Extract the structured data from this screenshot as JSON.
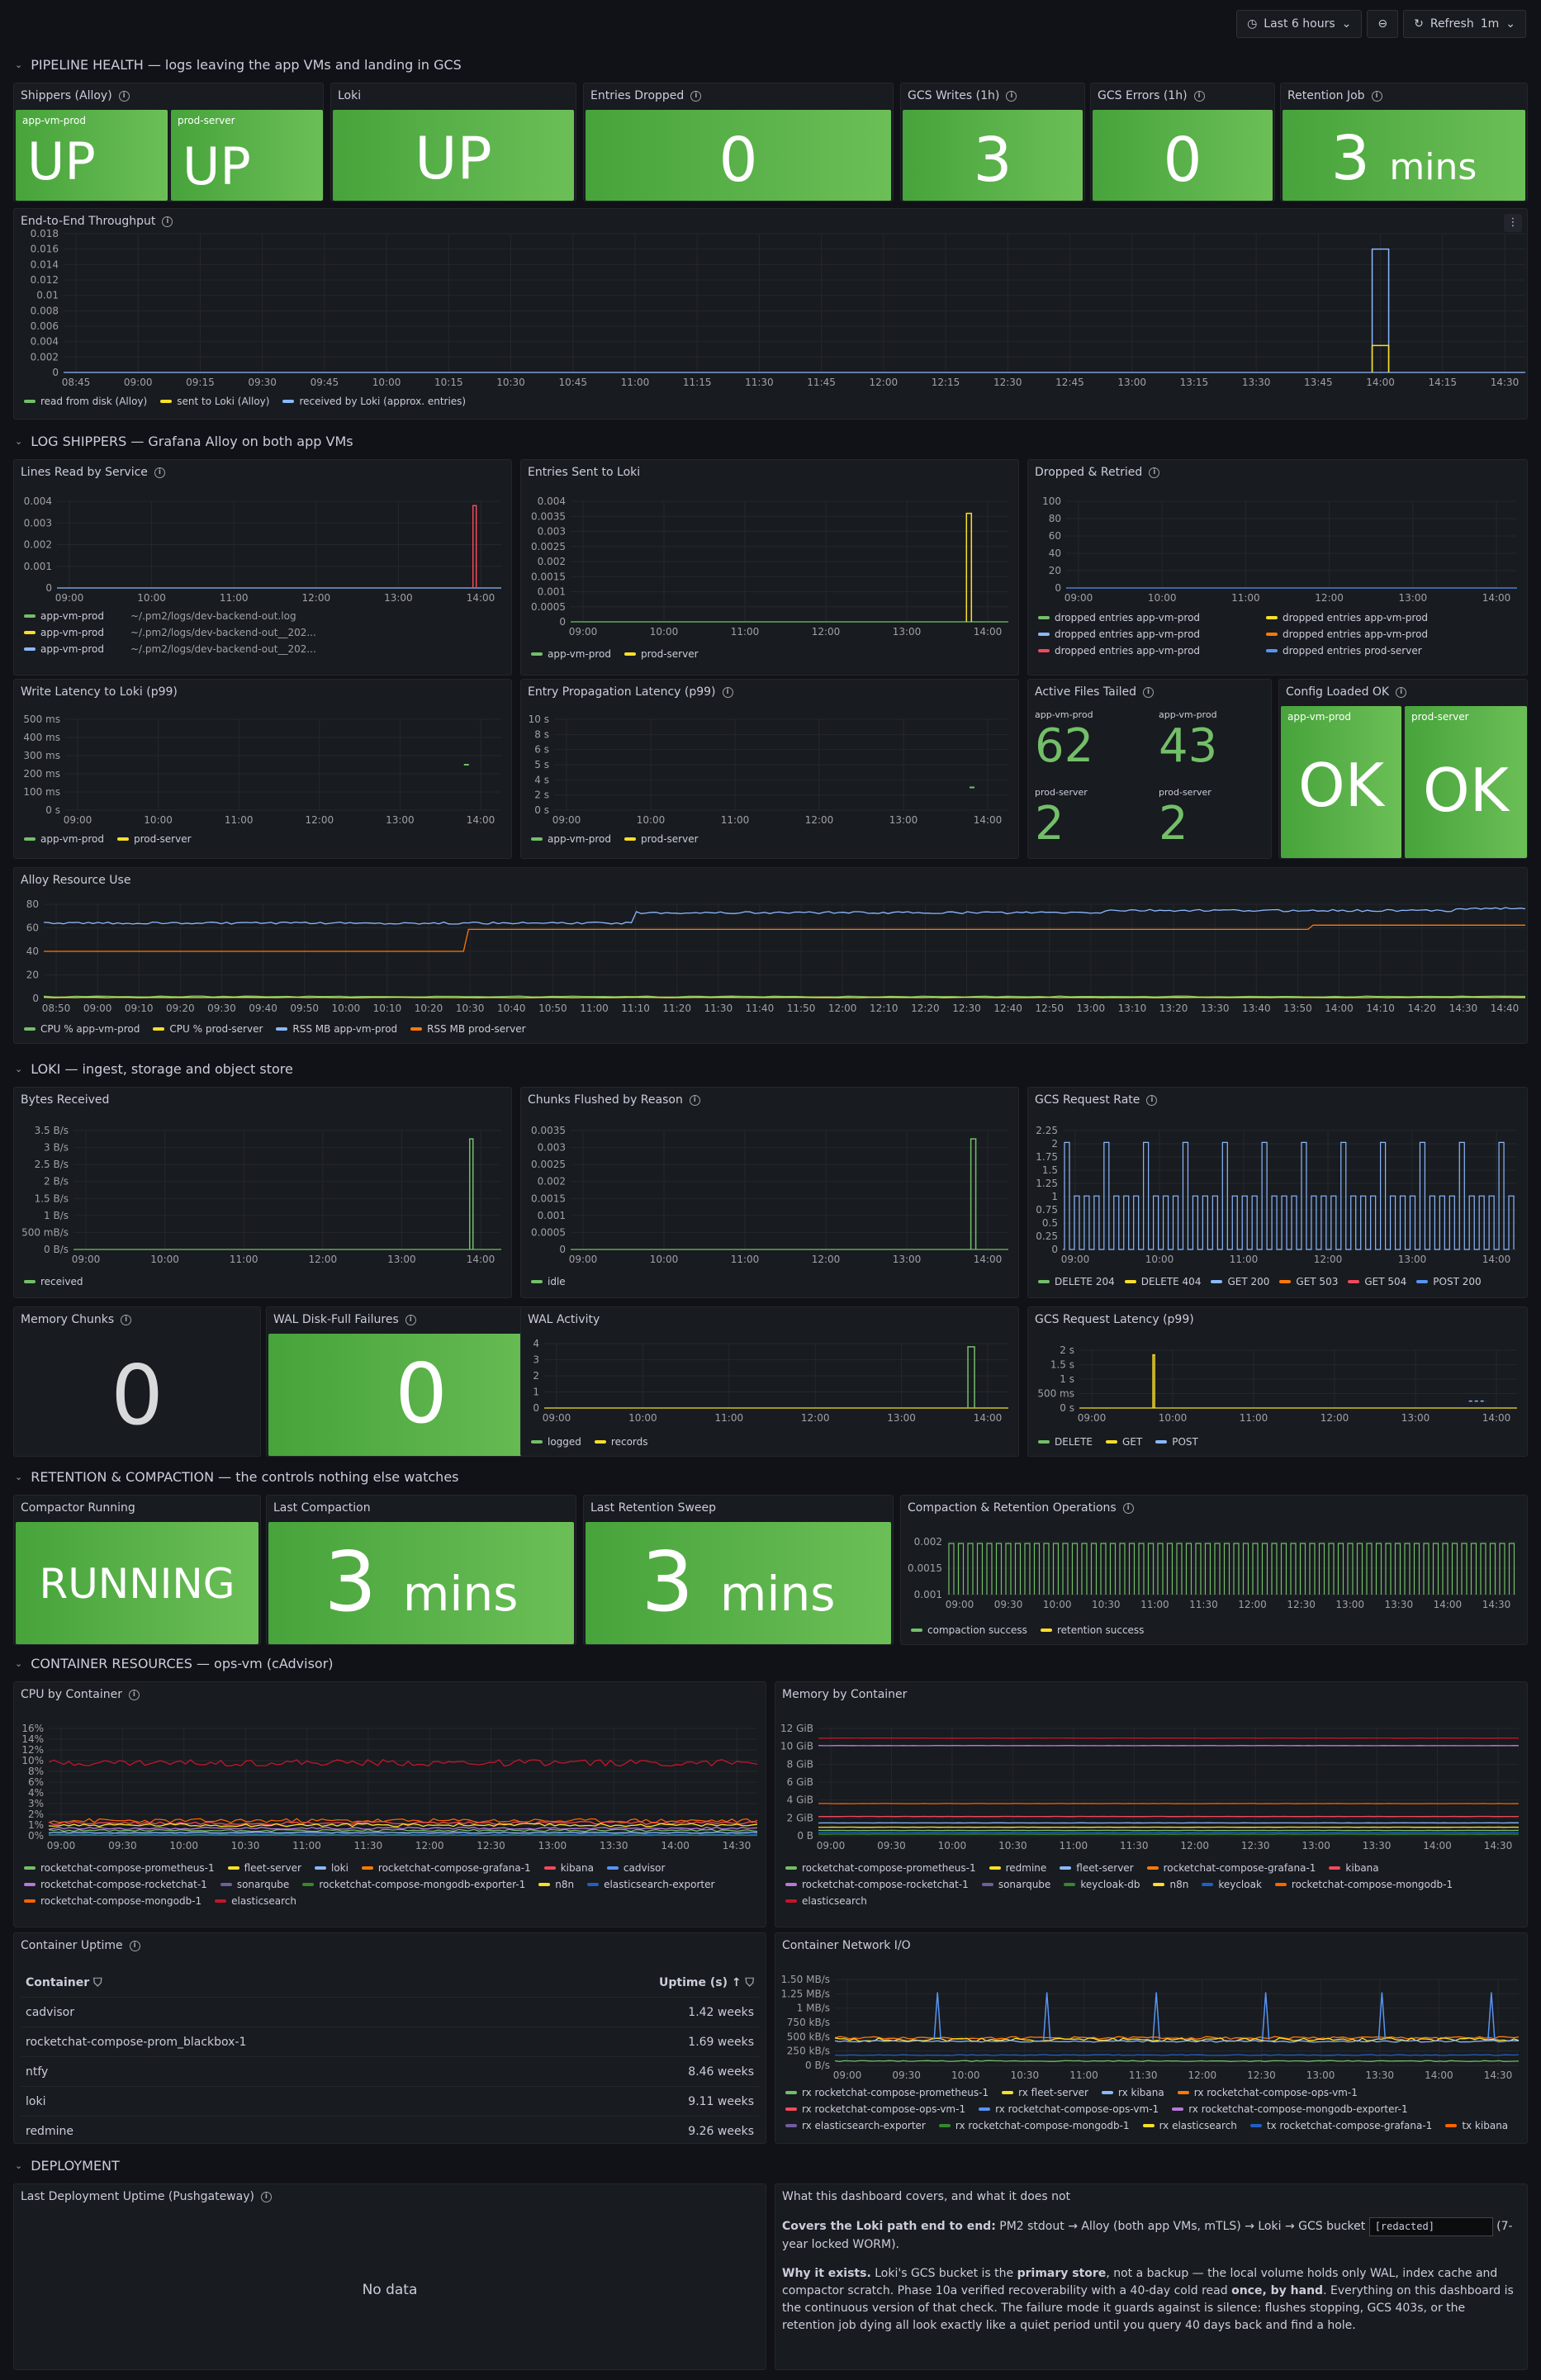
{
  "toolbar": {
    "time_range": "Last 6 hours",
    "refresh": "Refresh",
    "interval": "1m"
  },
  "rows": {
    "pipeline": "PIPELINE HEALTH — logs leaving the app VMs and landing in GCS",
    "shippers": "LOG SHIPPERS — Grafana Alloy on both app VMs",
    "loki": "LOKI — ingest, storage and object store",
    "retention": "RETENTION & COMPACTION — the controls nothing else watches",
    "containers": "CONTAINER RESOURCES — ops-vm (cAdvisor)",
    "deployment": "DEPLOYMENT"
  },
  "panels": {
    "shippers_alloy": {
      "title": "Shippers (Alloy)",
      "items": [
        {
          "sub": "app-vm-prod",
          "value": "UP"
        },
        {
          "sub": "prod-server",
          "value": "UP"
        }
      ]
    },
    "loki": {
      "title": "Loki",
      "value": "UP"
    },
    "entries_dropped": {
      "title": "Entries Dropped",
      "value": "0"
    },
    "gcs_writes": {
      "title": "GCS Writes (1h)",
      "value": "3"
    },
    "gcs_errors": {
      "title": "GCS Errors (1h)",
      "value": "0"
    },
    "retention_job": {
      "title": "Retention Job",
      "value": "3",
      "unit": "mins"
    },
    "throughput": {
      "title": "End-to-End Throughput"
    },
    "lines_read": {
      "title": "Lines Read by Service"
    },
    "entries_sent": {
      "title": "Entries Sent to Loki"
    },
    "dropped_retried": {
      "title": "Dropped & Retried"
    },
    "write_latency": {
      "title": "Write Latency to Loki (p99)"
    },
    "entry_propagation": {
      "title": "Entry Propagation Latency (p99)"
    },
    "active_files": {
      "title": "Active Files Tailed",
      "items": [
        {
          "sub": "app-vm-prod",
          "value": "62"
        },
        {
          "sub": "app-vm-prod",
          "value": "43"
        },
        {
          "sub": "prod-server",
          "value": "2"
        },
        {
          "sub": "prod-server",
          "value": "2"
        }
      ]
    },
    "config_loaded": {
      "title": "Config Loaded OK",
      "items": [
        {
          "sub": "app-vm-prod",
          "value": "OK"
        },
        {
          "sub": "prod-server",
          "value": "OK"
        }
      ]
    },
    "alloy_resource": {
      "title": "Alloy Resource Use"
    },
    "bytes_received": {
      "title": "Bytes Received"
    },
    "chunks_flushed": {
      "title": "Chunks Flushed by Reason"
    },
    "gcs_request_rate": {
      "title": "GCS Request Rate"
    },
    "memory_chunks": {
      "title": "Memory Chunks",
      "value": "0"
    },
    "wal_disk_full": {
      "title": "WAL Disk-Full Failures",
      "value": "0"
    },
    "wal_activity": {
      "title": "WAL Activity"
    },
    "gcs_request_latency": {
      "title": "GCS Request Latency (p99)"
    },
    "compactor_running": {
      "title": "Compactor Running",
      "value": "RUNNING"
    },
    "last_compaction": {
      "title": "Last Compaction",
      "value": "3",
      "unit": "mins"
    },
    "last_retention": {
      "title": "Last Retention Sweep",
      "value": "3",
      "unit": "mins"
    },
    "compaction_ops": {
      "title": "Compaction & Retention Operations"
    },
    "cpu_by_container": {
      "title": "CPU by Container"
    },
    "memory_by_container": {
      "title": "Memory by Container"
    },
    "container_uptime": {
      "title": "Container Uptime",
      "col1": "Container",
      "col2": "Uptime (s)",
      "rows": [
        [
          "cadvisor",
          "1.42 weeks"
        ],
        [
          "rocketchat-compose-prom_blackbox-1",
          "1.69 weeks"
        ],
        [
          "ntfy",
          "8.46 weeks"
        ],
        [
          "loki",
          "9.11 weeks"
        ],
        [
          "redmine",
          "9.26 weeks"
        ]
      ]
    },
    "container_network": {
      "title": "Container Network I/O"
    },
    "last_deployment": {
      "title": "Last Deployment Uptime (Pushgateway)",
      "nodata": "No data"
    },
    "text_panel": {
      "title": "What this dashboard covers, and what it does not",
      "p1a": "Covers the Loki path end to end:",
      "p1b": " PM2 stdout → Alloy (both app VMs, mTLS) → Loki → GCS bucket ",
      "redacted": "[redacted]",
      "p1c": " (7-year locked WORM).",
      "p2a": "Why it exists.",
      "p2b": " Loki's GCS bucket is the ",
      "p2c": "primary store",
      "p2d": ", not a backup — the local volume holds only WAL, index cache and compactor scratch. Phase 10a verified recoverability with a 40-day cold read ",
      "p2e": "once, by hand",
      "p2f": ". Everything on this dashboard is the continuous version of that check. The failure mode it guards against is silence: flushes stopping, GCS 403s, or the retention job dying all look exactly like a quiet period until you query 40 days back and find a hole."
    }
  },
  "chart_data": [
    {
      "id": "throughput",
      "type": "line",
      "x": [
        "08:45",
        "09:00",
        "09:15",
        "09:30",
        "09:45",
        "10:00",
        "10:15",
        "10:30",
        "10:45",
        "11:00",
        "11:15",
        "11:30",
        "11:45",
        "12:00",
        "12:15",
        "12:30",
        "12:45",
        "13:00",
        "13:15",
        "13:30",
        "13:45",
        "14:00",
        "14:15",
        "14:30"
      ],
      "yticks": [
        "0",
        "0.002",
        "0.004",
        "0.006",
        "0.008",
        "0.01",
        "0.012",
        "0.014",
        "0.016",
        "0.018"
      ],
      "ylim": [
        0,
        0.018
      ],
      "series": [
        {
          "name": "read from disk (Alloy)",
          "color": "#73bf69"
        },
        {
          "name": "sent to Loki (Alloy)",
          "color": "#fade2a"
        },
        {
          "name": "received by Loki (approx. entries)",
          "color": "#8ab8ff"
        }
      ],
      "spikes": [
        {
          "x": "14:00",
          "read": 0.0035,
          "sent": 0.0035,
          "received": 0.016
        }
      ]
    },
    {
      "id": "lines_read",
      "type": "line",
      "x": [
        "09:00",
        "10:00",
        "11:00",
        "12:00",
        "13:00",
        "14:00"
      ],
      "yticks": [
        "0",
        "0.001",
        "0.002",
        "0.003",
        "0.004"
      ],
      "ylim": [
        0,
        0.004
      ],
      "series": [
        {
          "name": "app-vm-prod",
          "label": "~/.pm2/logs/dev-backend-out.log",
          "color": "#73bf69"
        },
        {
          "name": "app-vm-prod",
          "label": "~/.pm2/logs/dev-backend-out__202...",
          "color": "#fade2a"
        },
        {
          "name": "app-vm-prod",
          "label": "~/.pm2/logs/dev-backend-out__202...",
          "color": "#8ab8ff"
        }
      ]
    },
    {
      "id": "entries_sent",
      "type": "line",
      "x": [
        "09:00",
        "10:00",
        "11:00",
        "12:00",
        "13:00",
        "14:00"
      ],
      "yticks": [
        "0",
        "0.0005",
        "0.001",
        "0.0015",
        "0.002",
        "0.0025",
        "0.003",
        "0.0035",
        "0.004"
      ],
      "ylim": [
        0,
        0.004
      ],
      "series": [
        {
          "name": "app-vm-prod",
          "color": "#73bf69"
        },
        {
          "name": "prod-server",
          "color": "#fade2a"
        }
      ]
    },
    {
      "id": "dropped_retried",
      "type": "line",
      "x": [
        "09:00",
        "10:00",
        "11:00",
        "12:00",
        "13:00",
        "14:00"
      ],
      "yticks": [
        "0",
        "20",
        "40",
        "60",
        "80",
        "100"
      ],
      "ylim": [
        0,
        100
      ],
      "series": [
        {
          "name": "dropped entries app-vm-prod",
          "color": "#73bf69"
        },
        {
          "name": "dropped entries app-vm-prod",
          "color": "#fade2a"
        },
        {
          "name": "dropped entries app-vm-prod",
          "color": "#8ab8ff"
        },
        {
          "name": "dropped entries app-vm-prod",
          "color": "#ff780a"
        },
        {
          "name": "dropped entries app-vm-prod",
          "color": "#f2495c"
        },
        {
          "name": "dropped entries prod-server",
          "color": "#5794f2"
        }
      ]
    },
    {
      "id": "write_latency",
      "type": "line",
      "x": [
        "09:00",
        "10:00",
        "11:00",
        "12:00",
        "13:00",
        "14:00"
      ],
      "yticks": [
        "0 s",
        "100 ms",
        "200 ms",
        "300 ms",
        "400 ms",
        "500 ms"
      ],
      "series": [
        {
          "name": "app-vm-prod",
          "color": "#73bf69"
        },
        {
          "name": "prod-server",
          "color": "#fade2a"
        }
      ]
    },
    {
      "id": "entry_propagation",
      "type": "line",
      "x": [
        "09:00",
        "10:00",
        "11:00",
        "12:00",
        "13:00",
        "14:00"
      ],
      "yticks": [
        "0 s",
        "2 s",
        "4 s",
        "5 s",
        "6 s",
        "8 s",
        "10 s"
      ],
      "series": [
        {
          "name": "app-vm-prod",
          "color": "#73bf69"
        },
        {
          "name": "prod-server",
          "color": "#fade2a"
        }
      ]
    },
    {
      "id": "alloy_resource",
      "type": "line",
      "x": [
        "08:50",
        "09:00",
        "09:10",
        "09:20",
        "09:30",
        "09:40",
        "09:50",
        "10:00",
        "10:10",
        "10:20",
        "10:30",
        "10:40",
        "10:50",
        "11:00",
        "11:10",
        "11:20",
        "11:30",
        "11:40",
        "11:50",
        "12:00",
        "12:10",
        "12:20",
        "12:30",
        "12:40",
        "12:50",
        "13:00",
        "13:10",
        "13:20",
        "13:30",
        "13:40",
        "13:50",
        "14:00",
        "14:10",
        "14:20",
        "14:30",
        "14:40"
      ],
      "yticks": [
        "0",
        "20",
        "40",
        "60",
        "80"
      ],
      "ylim": [
        0,
        90
      ],
      "series": [
        {
          "name": "CPU % app-vm-prod",
          "color": "#73bf69"
        },
        {
          "name": "CPU % prod-server",
          "color": "#fade2a"
        },
        {
          "name": "RSS MB app-vm-prod",
          "color": "#8ab8ff"
        },
        {
          "name": "RSS MB prod-server",
          "color": "#ff780a"
        }
      ]
    },
    {
      "id": "bytes_received",
      "type": "line",
      "x": [
        "09:00",
        "10:00",
        "11:00",
        "12:00",
        "13:00",
        "14:00"
      ],
      "yticks": [
        "0 B/s",
        "500 mB/s",
        "1 B/s",
        "1.5 B/s",
        "2 B/s",
        "2.5 B/s",
        "3 B/s",
        "3.5 B/s"
      ],
      "series": [
        {
          "name": "received",
          "color": "#73bf69"
        }
      ]
    },
    {
      "id": "chunks_flushed",
      "type": "line",
      "x": [
        "09:00",
        "10:00",
        "11:00",
        "12:00",
        "13:00",
        "14:00"
      ],
      "yticks": [
        "0",
        "0.0005",
        "0.001",
        "0.0015",
        "0.002",
        "0.0025",
        "0.003",
        "0.0035"
      ],
      "series": [
        {
          "name": "idle",
          "color": "#73bf69"
        }
      ]
    },
    {
      "id": "gcs_request_rate",
      "type": "line",
      "x": [
        "09:00",
        "10:00",
        "11:00",
        "12:00",
        "13:00",
        "14:00"
      ],
      "yticks": [
        "0",
        "0.25",
        "0.5",
        "0.75",
        "1",
        "1.25",
        "1.5",
        "1.75",
        "2",
        "2.25"
      ],
      "series": [
        {
          "name": "DELETE 204",
          "color": "#73bf69"
        },
        {
          "name": "DELETE 404",
          "color": "#fade2a"
        },
        {
          "name": "GET 200",
          "color": "#8ab8ff"
        },
        {
          "name": "GET 503",
          "color": "#ff780a"
        },
        {
          "name": "GET 504",
          "color": "#f2495c"
        },
        {
          "name": "POST 200",
          "color": "#5794f2"
        }
      ]
    },
    {
      "id": "wal_activity",
      "type": "line",
      "x": [
        "09:00",
        "10:00",
        "11:00",
        "12:00",
        "13:00",
        "14:00"
      ],
      "yticks": [
        "0",
        "1",
        "2",
        "3",
        "4"
      ],
      "series": [
        {
          "name": "logged",
          "color": "#73bf69"
        },
        {
          "name": "records",
          "color": "#fade2a"
        }
      ]
    },
    {
      "id": "gcs_request_latency",
      "type": "line",
      "x": [
        "09:00",
        "10:00",
        "11:00",
        "12:00",
        "13:00",
        "14:00"
      ],
      "yticks": [
        "0 s",
        "500 ms",
        "1 s",
        "1.5 s",
        "2 s"
      ],
      "series": [
        {
          "name": "DELETE",
          "color": "#73bf69"
        },
        {
          "name": "GET",
          "color": "#fade2a"
        },
        {
          "name": "POST",
          "color": "#8ab8ff"
        }
      ]
    },
    {
      "id": "compaction_ops",
      "type": "line",
      "x": [
        "09:00",
        "09:30",
        "10:00",
        "10:30",
        "11:00",
        "11:30",
        "12:00",
        "12:30",
        "13:00",
        "13:30",
        "14:00",
        "14:30"
      ],
      "yticks": [
        "0.001",
        "0.0015",
        "0.002"
      ],
      "series": [
        {
          "name": "compaction success",
          "color": "#73bf69"
        },
        {
          "name": "retention success",
          "color": "#fade2a"
        }
      ]
    },
    {
      "id": "cpu_by_container",
      "type": "line",
      "x": [
        "09:00",
        "09:30",
        "10:00",
        "10:30",
        "11:00",
        "11:30",
        "12:00",
        "12:30",
        "13:00",
        "13:30",
        "14:00",
        "14:30"
      ],
      "yticks": [
        "0%",
        "1%",
        "2%",
        "3%",
        "4%",
        "6%",
        "8%",
        "10%",
        "12%",
        "14%",
        "16%"
      ],
      "series": [
        {
          "name": "rocketchat-compose-prometheus-1",
          "color": "#73bf69"
        },
        {
          "name": "fleet-server",
          "color": "#fade2a"
        },
        {
          "name": "loki",
          "color": "#8ab8ff"
        },
        {
          "name": "rocketchat-compose-grafana-1",
          "color": "#ff780a"
        },
        {
          "name": "kibana",
          "color": "#f2495c"
        },
        {
          "name": "cadvisor",
          "color": "#5794f2"
        },
        {
          "name": "rocketchat-compose-rocketchat-1",
          "color": "#b877d9"
        },
        {
          "name": "sonarqube",
          "color": "#705da0"
        },
        {
          "name": "rocketchat-compose-mongodb-exporter-1",
          "color": "#37872d"
        },
        {
          "name": "n8n",
          "color": "#fade2a"
        },
        {
          "name": "elasticsearch-exporter",
          "color": "#1f60c4"
        },
        {
          "name": "rocketchat-compose-mongodb-1",
          "color": "#fa6400"
        },
        {
          "name": "elasticsearch",
          "color": "#c4162a"
        }
      ]
    },
    {
      "id": "memory_by_container",
      "type": "line",
      "x": [
        "09:00",
        "09:30",
        "10:00",
        "10:30",
        "11:00",
        "11:30",
        "12:00",
        "12:30",
        "13:00",
        "13:30",
        "14:00",
        "14:30"
      ],
      "yticks": [
        "0 B",
        "2 GiB",
        "4 GiB",
        "6 GiB",
        "8 GiB",
        "10 GiB",
        "12 GiB"
      ],
      "series": [
        {
          "name": "rocketchat-compose-prometheus-1",
          "color": "#73bf69"
        },
        {
          "name": "redmine",
          "color": "#fade2a"
        },
        {
          "name": "fleet-server",
          "color": "#8ab8ff"
        },
        {
          "name": "rocketchat-compose-grafana-1",
          "color": "#ff780a"
        },
        {
          "name": "kibana",
          "color": "#f2495c"
        },
        {
          "name": "rocketchat-compose-rocketchat-1",
          "color": "#b877d9"
        },
        {
          "name": "sonarqube",
          "color": "#705da0"
        },
        {
          "name": "keycloak-db",
          "color": "#37872d"
        },
        {
          "name": "n8n",
          "color": "#fade2a"
        },
        {
          "name": "keycloak",
          "color": "#1f60c4"
        },
        {
          "name": "rocketchat-compose-mongodb-1",
          "color": "#fa6400"
        },
        {
          "name": "elasticsearch",
          "color": "#c4162a"
        }
      ]
    },
    {
      "id": "container_network",
      "type": "line",
      "x": [
        "09:00",
        "09:30",
        "10:00",
        "10:30",
        "11:00",
        "11:30",
        "12:00",
        "12:30",
        "13:00",
        "13:30",
        "14:00",
        "14:30"
      ],
      "yticks": [
        "0 B/s",
        "250 kB/s",
        "500 kB/s",
        "750 kB/s",
        "1 MB/s",
        "1.25 MB/s",
        "1.50 MB/s"
      ],
      "series": [
        {
          "name": "rx rocketchat-compose-prometheus-1",
          "color": "#73bf69"
        },
        {
          "name": "rx fleet-server",
          "color": "#fade2a"
        },
        {
          "name": "rx kibana",
          "color": "#8ab8ff"
        },
        {
          "name": "rx rocketchat-compose-ops-vm-1",
          "color": "#ff780a"
        },
        {
          "name": "rx rocketchat-compose-ops-vm-1",
          "color": "#f2495c"
        },
        {
          "name": "rx rocketchat-compose-ops-vm-1",
          "color": "#5794f2"
        },
        {
          "name": "rx rocketchat-compose-mongodb-exporter-1",
          "color": "#b877d9"
        },
        {
          "name": "rx elasticsearch-exporter",
          "color": "#705da0"
        },
        {
          "name": "rx rocketchat-compose-mongodb-1",
          "color": "#37872d"
        },
        {
          "name": "rx elasticsearch",
          "color": "#fade2a"
        },
        {
          "name": "tx rocketchat-compose-grafana-1",
          "color": "#1f60c4"
        },
        {
          "name": "tx kibana",
          "color": "#fa6400"
        }
      ]
    }
  ]
}
